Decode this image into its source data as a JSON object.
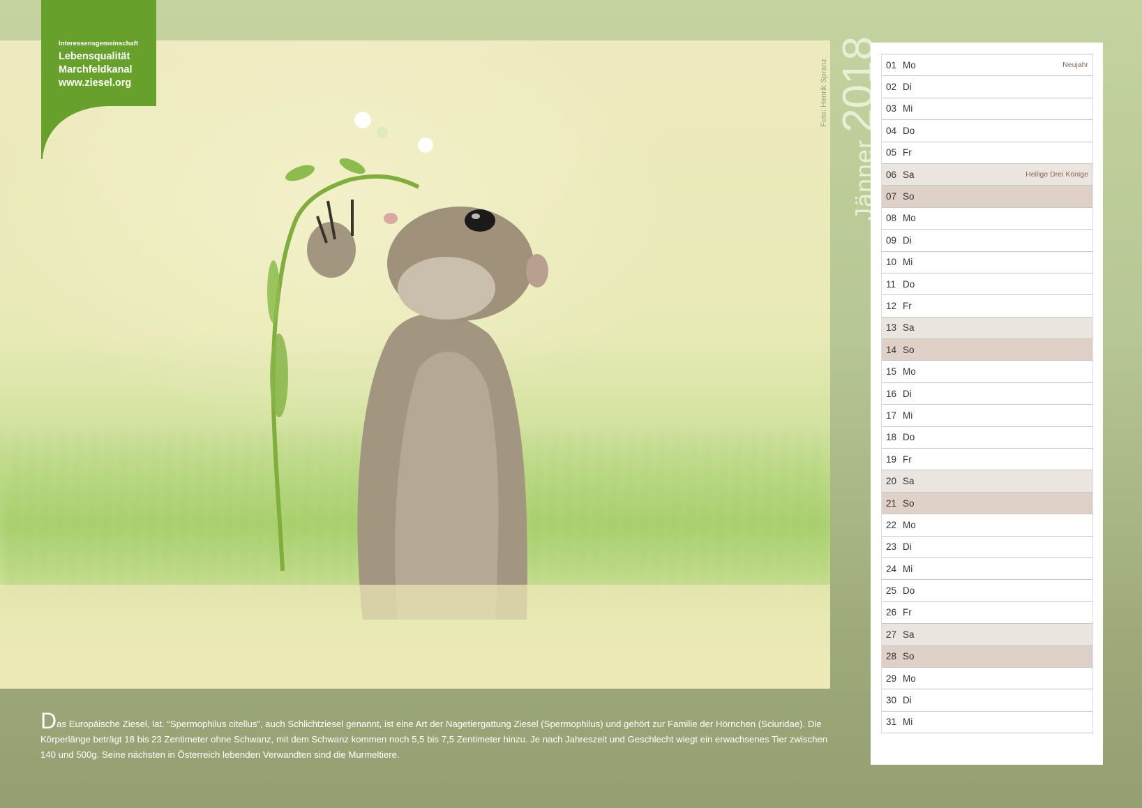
{
  "logo": {
    "line1": "Interessensgemeinschaft",
    "line2": "Lebensqualität",
    "line3": "Marchfeldkanal",
    "line4": "www.ziesel.org",
    "color": "#67a02a"
  },
  "header": {
    "month": "Jänner",
    "year": "2018"
  },
  "photo": {
    "credit": "Foto: Henrik Spranz"
  },
  "calendar": {
    "days": [
      {
        "num": "01",
        "name": "Mo",
        "holiday": "Neujahr"
      },
      {
        "num": "02",
        "name": "Di",
        "holiday": ""
      },
      {
        "num": "03",
        "name": "Mi",
        "holiday": ""
      },
      {
        "num": "04",
        "name": "Do",
        "holiday": ""
      },
      {
        "num": "05",
        "name": "Fr",
        "holiday": ""
      },
      {
        "num": "06",
        "name": "Sa",
        "holiday": "Heilige Drei Könige"
      },
      {
        "num": "07",
        "name": "So",
        "holiday": ""
      },
      {
        "num": "08",
        "name": "Mo",
        "holiday": ""
      },
      {
        "num": "09",
        "name": "Di",
        "holiday": ""
      },
      {
        "num": "10",
        "name": "Mi",
        "holiday": ""
      },
      {
        "num": "11",
        "name": "Do",
        "holiday": ""
      },
      {
        "num": "12",
        "name": "Fr",
        "holiday": ""
      },
      {
        "num": "13",
        "name": "Sa",
        "holiday": ""
      },
      {
        "num": "14",
        "name": "So",
        "holiday": ""
      },
      {
        "num": "15",
        "name": "Mo",
        "holiday": ""
      },
      {
        "num": "16",
        "name": "Di",
        "holiday": ""
      },
      {
        "num": "17",
        "name": "Mi",
        "holiday": ""
      },
      {
        "num": "18",
        "name": "Do",
        "holiday": ""
      },
      {
        "num": "19",
        "name": "Fr",
        "holiday": ""
      },
      {
        "num": "20",
        "name": "Sa",
        "holiday": ""
      },
      {
        "num": "21",
        "name": "So",
        "holiday": ""
      },
      {
        "num": "22",
        "name": "Mo",
        "holiday": ""
      },
      {
        "num": "23",
        "name": "Di",
        "holiday": ""
      },
      {
        "num": "24",
        "name": "Mi",
        "holiday": ""
      },
      {
        "num": "25",
        "name": "Do",
        "holiday": ""
      },
      {
        "num": "26",
        "name": "Fr",
        "holiday": ""
      },
      {
        "num": "27",
        "name": "Sa",
        "holiday": ""
      },
      {
        "num": "28",
        "name": "So",
        "holiday": ""
      },
      {
        "num": "29",
        "name": "Mo",
        "holiday": ""
      },
      {
        "num": "30",
        "name": "Di",
        "holiday": ""
      },
      {
        "num": "31",
        "name": "Mi",
        "holiday": ""
      }
    ],
    "saturday_color": "#ebe5e0",
    "sunday_color": "#dfd0c8"
  },
  "caption": {
    "dropcap": "D",
    "text": "as Europäische Ziesel, lat. “Spermophilus citellus”, auch Schlichtziesel genannt, ist eine Art der Nagetiergattung Ziesel (Spermophilus) und gehört zur Familie der Hörnchen (Sciuridae). Die Körperlänge beträgt 18 bis 23 Zentimeter ohne Schwanz, mit dem Schwanz kommen noch 5,5 bis 7,5 Zentimeter hinzu. Je nach Jahreszeit und Geschlecht wiegt ein erwachsenes Tier zwischen 140 und 500g. Seine nächsten in Österreich lebenden Verwandten sind die Murmeltiere."
  }
}
